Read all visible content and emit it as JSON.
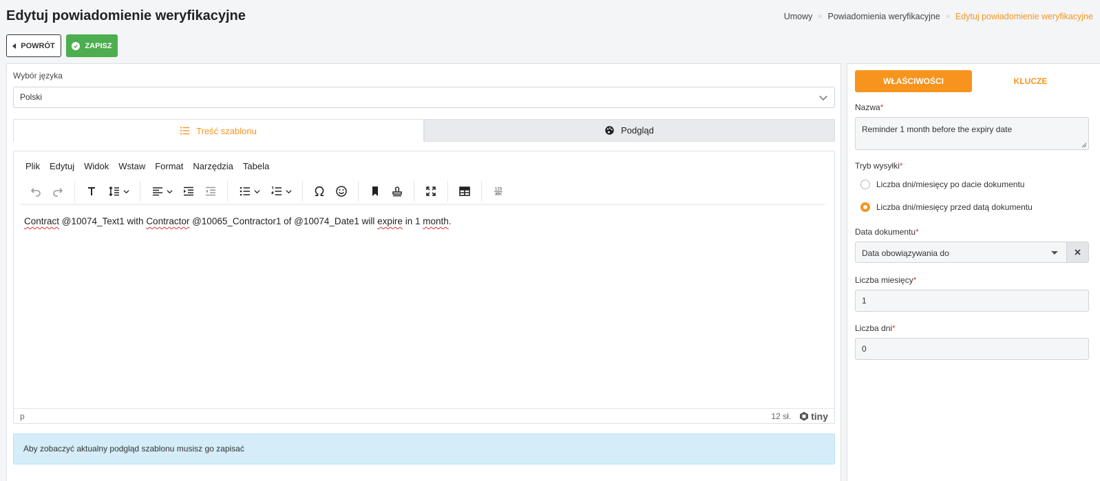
{
  "page": {
    "title": "Edytuj powiadomienie weryfikacyjne"
  },
  "breadcrumb": {
    "items": [
      "Umowy",
      "Powiadomienia weryfikacyjne"
    ],
    "active": "Edytuj powiadomienie weryfikacyjne",
    "separator": "»"
  },
  "actions": {
    "back_label": "POWRÓT",
    "save_label": "ZAPISZ"
  },
  "language": {
    "label": "Wybór języka",
    "selected": "Polski"
  },
  "tabs": {
    "content": "Treść szablonu",
    "preview": "Podgląd"
  },
  "editor": {
    "menu": [
      "Plik",
      "Edytuj",
      "Widok",
      "Wstaw",
      "Format",
      "Narzędzia",
      "Tabela"
    ],
    "content": {
      "w1": "Contract",
      "t1": " @10074_Text1 with ",
      "w2": "Contractor",
      "t2": " @10065_Contractor1 of @10074_Date1 will ",
      "w3": "expire",
      "t3": " in 1 ",
      "w4": "month",
      "t4": "."
    },
    "status_path": "p",
    "word_count": "12 sł.",
    "brand": "tiny"
  },
  "info_message": "Aby zobaczyć aktualny podgląd szablonu musisz go zapisać",
  "sidebar": {
    "tab_properties": "WŁAŚCIWOŚCI",
    "tab_keys": "KLUCZE",
    "name_label": "Nazwa",
    "name_value": "Reminder 1 month before the expiry date",
    "send_mode_label": "Tryb wysyłki",
    "send_mode_after": "Liczba dni/miesięcy po dacie dokumentu",
    "send_mode_before": "Liczba dni/miesięcy przed datą dokumentu",
    "send_mode_selected": "before",
    "doc_date_label": "Data dokumentu",
    "doc_date_value": "Data obowiązywania do",
    "months_label": "Liczba miesięcy",
    "months_value": "1",
    "days_label": "Liczba dni",
    "days_value": "0",
    "required_mark": "*"
  },
  "colors": {
    "accent": "#f7941d",
    "success": "#4cae4f",
    "info_bg": "#d4edf8"
  }
}
